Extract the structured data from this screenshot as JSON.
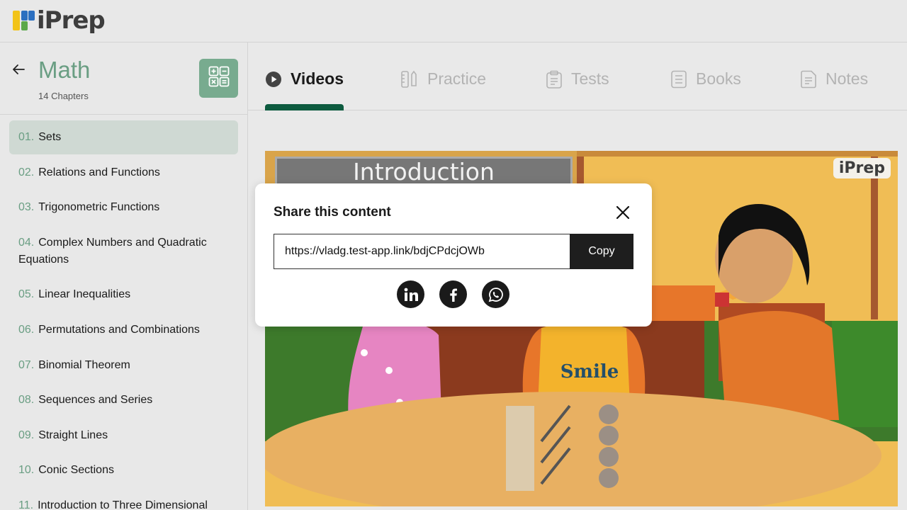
{
  "app": {
    "logo_text": "iPrep",
    "brand_colors": {
      "blue": "#2b6fc0",
      "yellow": "#f2c318",
      "green": "#5ba84a"
    }
  },
  "sidebar": {
    "subject": "Math",
    "chapter_count": "14 Chapters",
    "chapters": [
      {
        "num": "01.",
        "title": "Sets"
      },
      {
        "num": "02.",
        "title": "Relations and Functions"
      },
      {
        "num": "03.",
        "title": "Trigonometric Functions"
      },
      {
        "num": "04.",
        "title": "Complex Numbers and Quadratic Equations"
      },
      {
        "num": "05.",
        "title": "Linear Inequalities"
      },
      {
        "num": "06.",
        "title": "Permutations and Combinations"
      },
      {
        "num": "07.",
        "title": "Binomial Theorem"
      },
      {
        "num": "08.",
        "title": "Sequences and Series"
      },
      {
        "num": "09.",
        "title": "Straight Lines"
      },
      {
        "num": "10.",
        "title": "Conic Sections"
      },
      {
        "num": "11.",
        "title": "Introduction to Three Dimensional"
      }
    ],
    "active_chapter_index": 0
  },
  "tabs": [
    {
      "label": "Videos",
      "icon": "play-circle-icon",
      "active": true
    },
    {
      "label": "Practice",
      "icon": "ruler-pencil-icon",
      "active": false
    },
    {
      "label": "Tests",
      "icon": "clipboard-icon",
      "active": false
    },
    {
      "label": "Books",
      "icon": "book-icon",
      "active": false
    },
    {
      "label": "Notes",
      "icon": "notes-icon",
      "active": false
    }
  ],
  "video": {
    "board_text": "Introduction",
    "watermark": "iPrep",
    "shirt_text": "Smile"
  },
  "share_modal": {
    "title": "Share this content",
    "link": "https://vladg.test-app.link/bdjCPdcjOWb",
    "copy_label": "Copy",
    "networks": [
      "linkedin-icon",
      "facebook-icon",
      "whatsapp-icon"
    ]
  },
  "colors": {
    "accent_green": "#6a9e83",
    "active_tab_underline": "#0d5b3f",
    "active_chapter_bg": "#cfd9d3"
  }
}
